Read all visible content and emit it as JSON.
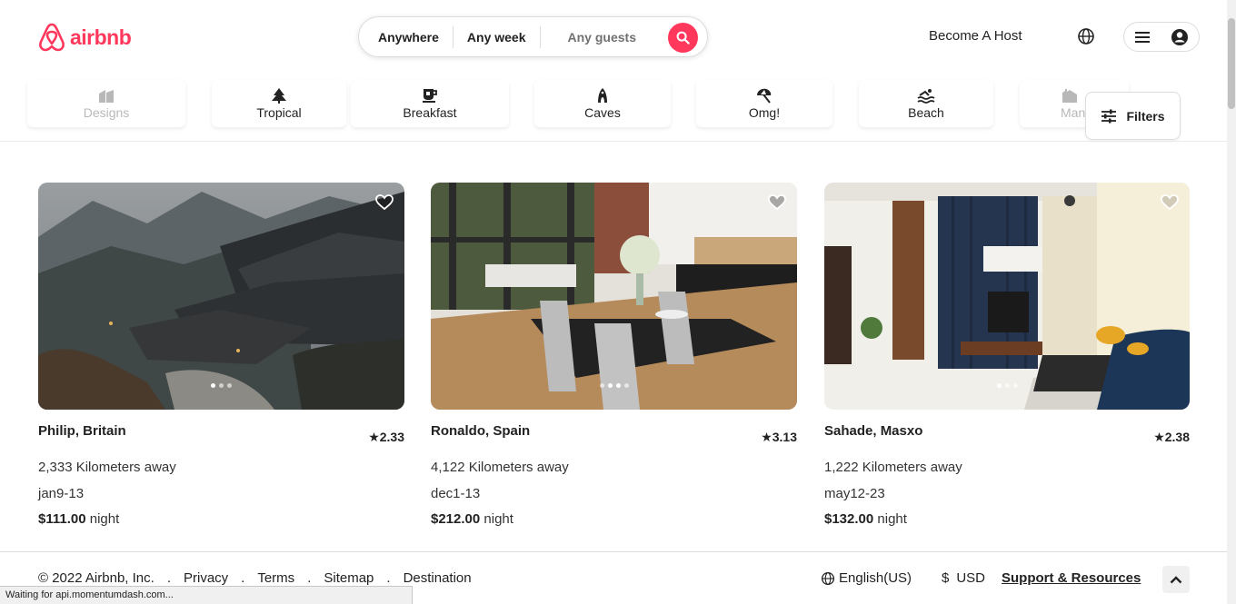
{
  "header": {
    "logo_text": "airbnb",
    "search": {
      "anywhere": "Anywhere",
      "any_week": "Any week",
      "any_guests": "Any guests"
    },
    "become_host": "Become A Host"
  },
  "categories": [
    {
      "label": "Designs",
      "icon": "designs-icon"
    },
    {
      "label": "Tropical",
      "icon": "tropical-icon"
    },
    {
      "label": "Breakfast",
      "icon": "breakfast-icon"
    },
    {
      "label": "Caves",
      "icon": "caves-icon"
    },
    {
      "label": "Omg!",
      "icon": "omg-icon"
    },
    {
      "label": "Beach",
      "icon": "beach-icon"
    },
    {
      "label": "Man",
      "icon": "mansions-icon"
    }
  ],
  "filters_label": "Filters",
  "listings": [
    {
      "place": "Philip, Britain",
      "rating": "2.33",
      "distance": "2,333 Kilometers away",
      "dates": "jan9-13",
      "price": "$111.00",
      "unit": "night"
    },
    {
      "place": "Ronaldo,  Spain",
      "rating": "3.13",
      "distance": "4,122 Kilometers away",
      "dates": "dec1-13",
      "price": "$212.00",
      "unit": "night"
    },
    {
      "place": "Sahade, Masxo",
      "rating": "2.38",
      "distance": "1,222 Kilometers away",
      "dates": "may12-23",
      "price": "$132.00",
      "unit": "night"
    }
  ],
  "footer": {
    "copyright": "© 2022 Airbnb, Inc.",
    "links": [
      "Privacy",
      "Terms",
      "Sitemap",
      "Destination"
    ],
    "separator": ".",
    "language": "English(US)",
    "currency_symbol": "$",
    "currency": "USD",
    "support": "Support & Resources"
  },
  "status_bar": "Waiting for api.momentumdash.com...",
  "colors": {
    "brand": "#ff385c"
  }
}
